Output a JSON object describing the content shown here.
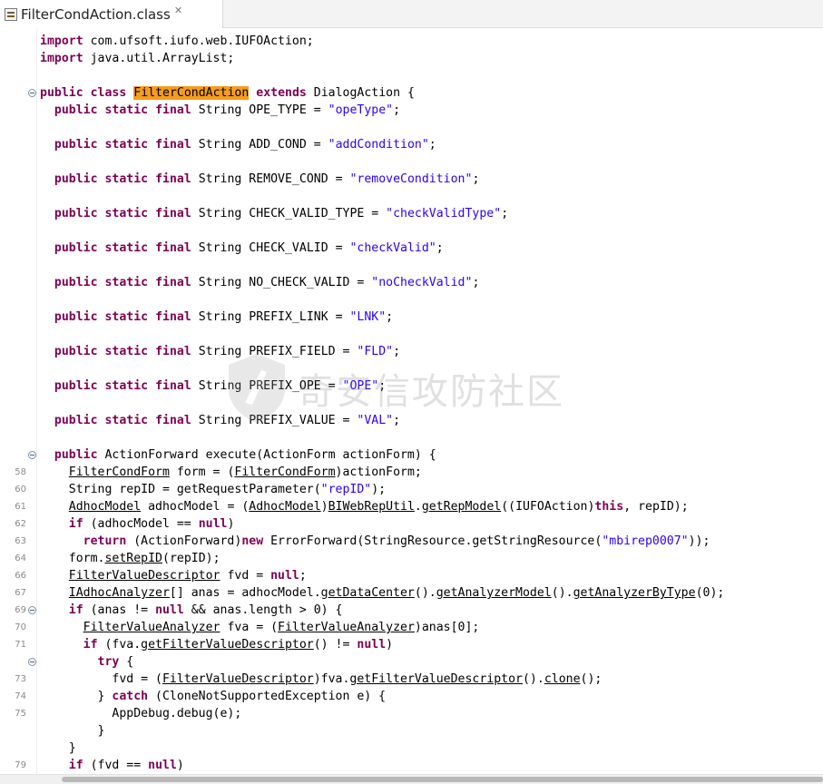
{
  "tab": {
    "title": "FilterCondAction.class",
    "icon": "class-file-icon",
    "close_glyph": "✕"
  },
  "watermark": {
    "text": "奇安信攻防社区"
  },
  "colors": {
    "keyword": "#7f0055",
    "string": "#2a00ff",
    "highlight": "#f59c1e",
    "line_number": "#8a8a8a"
  },
  "lines": [
    {
      "ln": "",
      "fold": false,
      "segs": [
        [
          "kw",
          "import"
        ],
        [
          "t",
          " com.ufsoft.iufo.web.IUFOAction;"
        ]
      ]
    },
    {
      "ln": "",
      "fold": false,
      "segs": [
        [
          "kw",
          "import"
        ],
        [
          "t",
          " java.util.ArrayList;"
        ]
      ]
    },
    {
      "ln": "",
      "fold": false,
      "segs": []
    },
    {
      "ln": "",
      "fold": true,
      "segs": [
        [
          "kw",
          "public"
        ],
        [
          "t",
          " "
        ],
        [
          "kw",
          "class"
        ],
        [
          "t",
          " "
        ],
        [
          "hl",
          "FilterCondAction"
        ],
        [
          "t",
          " "
        ],
        [
          "kw",
          "extends"
        ],
        [
          "t",
          " DialogAction {"
        ]
      ]
    },
    {
      "ln": "",
      "fold": false,
      "segs": [
        [
          "t",
          "  "
        ],
        [
          "kw",
          "public"
        ],
        [
          "t",
          " "
        ],
        [
          "kw",
          "static"
        ],
        [
          "t",
          " "
        ],
        [
          "kw",
          "final"
        ],
        [
          "t",
          " String OPE_TYPE = "
        ],
        [
          "str",
          "\"opeType\""
        ],
        [
          "t",
          ";"
        ]
      ]
    },
    {
      "ln": "",
      "fold": false,
      "segs": []
    },
    {
      "ln": "",
      "fold": false,
      "segs": [
        [
          "t",
          "  "
        ],
        [
          "kw",
          "public"
        ],
        [
          "t",
          " "
        ],
        [
          "kw",
          "static"
        ],
        [
          "t",
          " "
        ],
        [
          "kw",
          "final"
        ],
        [
          "t",
          " String ADD_COND = "
        ],
        [
          "str",
          "\"addCondition\""
        ],
        [
          "t",
          ";"
        ]
      ]
    },
    {
      "ln": "",
      "fold": false,
      "segs": []
    },
    {
      "ln": "",
      "fold": false,
      "segs": [
        [
          "t",
          "  "
        ],
        [
          "kw",
          "public"
        ],
        [
          "t",
          " "
        ],
        [
          "kw",
          "static"
        ],
        [
          "t",
          " "
        ],
        [
          "kw",
          "final"
        ],
        [
          "t",
          " String REMOVE_COND = "
        ],
        [
          "str",
          "\"removeCondition\""
        ],
        [
          "t",
          ";"
        ]
      ]
    },
    {
      "ln": "",
      "fold": false,
      "segs": []
    },
    {
      "ln": "",
      "fold": false,
      "segs": [
        [
          "t",
          "  "
        ],
        [
          "kw",
          "public"
        ],
        [
          "t",
          " "
        ],
        [
          "kw",
          "static"
        ],
        [
          "t",
          " "
        ],
        [
          "kw",
          "final"
        ],
        [
          "t",
          " String CHECK_VALID_TYPE = "
        ],
        [
          "str",
          "\"checkValidType\""
        ],
        [
          "t",
          ";"
        ]
      ]
    },
    {
      "ln": "",
      "fold": false,
      "segs": []
    },
    {
      "ln": "",
      "fold": false,
      "segs": [
        [
          "t",
          "  "
        ],
        [
          "kw",
          "public"
        ],
        [
          "t",
          " "
        ],
        [
          "kw",
          "static"
        ],
        [
          "t",
          " "
        ],
        [
          "kw",
          "final"
        ],
        [
          "t",
          " String CHECK_VALID = "
        ],
        [
          "str",
          "\"checkValid\""
        ],
        [
          "t",
          ";"
        ]
      ]
    },
    {
      "ln": "",
      "fold": false,
      "segs": []
    },
    {
      "ln": "",
      "fold": false,
      "segs": [
        [
          "t",
          "  "
        ],
        [
          "kw",
          "public"
        ],
        [
          "t",
          " "
        ],
        [
          "kw",
          "static"
        ],
        [
          "t",
          " "
        ],
        [
          "kw",
          "final"
        ],
        [
          "t",
          " String NO_CHECK_VALID = "
        ],
        [
          "str",
          "\"noCheckValid\""
        ],
        [
          "t",
          ";"
        ]
      ]
    },
    {
      "ln": "",
      "fold": false,
      "segs": []
    },
    {
      "ln": "",
      "fold": false,
      "segs": [
        [
          "t",
          "  "
        ],
        [
          "kw",
          "public"
        ],
        [
          "t",
          " "
        ],
        [
          "kw",
          "static"
        ],
        [
          "t",
          " "
        ],
        [
          "kw",
          "final"
        ],
        [
          "t",
          " String PREFIX_LINK = "
        ],
        [
          "str",
          "\"LNK\""
        ],
        [
          "t",
          ";"
        ]
      ]
    },
    {
      "ln": "",
      "fold": false,
      "segs": []
    },
    {
      "ln": "",
      "fold": false,
      "segs": [
        [
          "t",
          "  "
        ],
        [
          "kw",
          "public"
        ],
        [
          "t",
          " "
        ],
        [
          "kw",
          "static"
        ],
        [
          "t",
          " "
        ],
        [
          "kw",
          "final"
        ],
        [
          "t",
          " String PREFIX_FIELD = "
        ],
        [
          "str",
          "\"FLD\""
        ],
        [
          "t",
          ";"
        ]
      ]
    },
    {
      "ln": "",
      "fold": false,
      "segs": []
    },
    {
      "ln": "",
      "fold": false,
      "segs": [
        [
          "t",
          "  "
        ],
        [
          "kw",
          "public"
        ],
        [
          "t",
          " "
        ],
        [
          "kw",
          "static"
        ],
        [
          "t",
          " "
        ],
        [
          "kw",
          "final"
        ],
        [
          "t",
          " String PREFIX_OPE = "
        ],
        [
          "str",
          "\"OPE\""
        ],
        [
          "t",
          ";"
        ]
      ]
    },
    {
      "ln": "",
      "fold": false,
      "segs": []
    },
    {
      "ln": "",
      "fold": false,
      "segs": [
        [
          "t",
          "  "
        ],
        [
          "kw",
          "public"
        ],
        [
          "t",
          " "
        ],
        [
          "kw",
          "static"
        ],
        [
          "t",
          " "
        ],
        [
          "kw",
          "final"
        ],
        [
          "t",
          " String PREFIX_VALUE = "
        ],
        [
          "str",
          "\"VAL\""
        ],
        [
          "t",
          ";"
        ]
      ]
    },
    {
      "ln": "",
      "fold": false,
      "segs": []
    },
    {
      "ln": "",
      "fold": true,
      "segs": [
        [
          "t",
          "  "
        ],
        [
          "kw",
          "public"
        ],
        [
          "t",
          " ActionForward execute(ActionForm actionForm) {"
        ]
      ]
    },
    {
      "ln": "58",
      "fold": false,
      "segs": [
        [
          "t",
          "    "
        ],
        [
          "ul",
          "FilterCondForm"
        ],
        [
          "t",
          " form = ("
        ],
        [
          "ul",
          "FilterCondForm"
        ],
        [
          "t",
          ")actionForm;"
        ]
      ]
    },
    {
      "ln": "60",
      "fold": false,
      "segs": [
        [
          "t",
          "    String repID = getRequestParameter("
        ],
        [
          "str",
          "\"repID\""
        ],
        [
          "t",
          ");"
        ]
      ]
    },
    {
      "ln": "61",
      "fold": false,
      "segs": [
        [
          "t",
          "    "
        ],
        [
          "ul",
          "AdhocModel"
        ],
        [
          "t",
          " adhocModel = ("
        ],
        [
          "ul",
          "AdhocModel"
        ],
        [
          "t",
          ")"
        ],
        [
          "ul",
          "BIWebRepUtil"
        ],
        [
          "t",
          "."
        ],
        [
          "ul",
          "getRepModel"
        ],
        [
          "t",
          "((IUFOAction)"
        ],
        [
          "kw",
          "this"
        ],
        [
          "t",
          ", repID);"
        ]
      ]
    },
    {
      "ln": "62",
      "fold": false,
      "segs": [
        [
          "t",
          "    "
        ],
        [
          "kw",
          "if"
        ],
        [
          "t",
          " (adhocModel == "
        ],
        [
          "kw",
          "null"
        ],
        [
          "t",
          ")"
        ]
      ]
    },
    {
      "ln": "63",
      "fold": false,
      "segs": [
        [
          "t",
          "      "
        ],
        [
          "kw",
          "return"
        ],
        [
          "t",
          " (ActionForward)"
        ],
        [
          "kw",
          "new"
        ],
        [
          "t",
          " ErrorForward(StringResource.getStringResource("
        ],
        [
          "str",
          "\"mbirep0007\""
        ],
        [
          "t",
          "));"
        ]
      ]
    },
    {
      "ln": "64",
      "fold": false,
      "segs": [
        [
          "t",
          "    form."
        ],
        [
          "ul",
          "setRepID"
        ],
        [
          "t",
          "(repID);"
        ]
      ]
    },
    {
      "ln": "66",
      "fold": false,
      "segs": [
        [
          "t",
          "    "
        ],
        [
          "ul",
          "FilterValueDescriptor"
        ],
        [
          "t",
          " fvd = "
        ],
        [
          "kw",
          "null"
        ],
        [
          "t",
          ";"
        ]
      ]
    },
    {
      "ln": "67",
      "fold": false,
      "segs": [
        [
          "t",
          "    "
        ],
        [
          "ul",
          "IAdhocAnalyzer"
        ],
        [
          "t",
          "[] anas = adhocModel."
        ],
        [
          "ul",
          "getDataCenter"
        ],
        [
          "t",
          "()."
        ],
        [
          "ul",
          "getAnalyzerModel"
        ],
        [
          "t",
          "()."
        ],
        [
          "ul",
          "getAnalyzerByType"
        ],
        [
          "t",
          "(0);"
        ]
      ]
    },
    {
      "ln": "69",
      "fold": true,
      "segs": [
        [
          "t",
          "    "
        ],
        [
          "kw",
          "if"
        ],
        [
          "t",
          " (anas != "
        ],
        [
          "kw",
          "null"
        ],
        [
          "t",
          " && anas.length > 0) {"
        ]
      ]
    },
    {
      "ln": "70",
      "fold": false,
      "segs": [
        [
          "t",
          "      "
        ],
        [
          "ul",
          "FilterValueAnalyzer"
        ],
        [
          "t",
          " fva = ("
        ],
        [
          "ul",
          "FilterValueAnalyzer"
        ],
        [
          "t",
          ")anas[0];"
        ]
      ]
    },
    {
      "ln": "71",
      "fold": false,
      "segs": [
        [
          "t",
          "      "
        ],
        [
          "kw",
          "if"
        ],
        [
          "t",
          " (fva."
        ],
        [
          "ul",
          "getFilterValueDescriptor"
        ],
        [
          "t",
          "() != "
        ],
        [
          "kw",
          "null"
        ],
        [
          "t",
          ")"
        ]
      ]
    },
    {
      "ln": "",
      "fold": true,
      "segs": [
        [
          "t",
          "        "
        ],
        [
          "kw",
          "try"
        ],
        [
          "t",
          " {"
        ]
      ]
    },
    {
      "ln": "73",
      "fold": false,
      "segs": [
        [
          "t",
          "          fvd = ("
        ],
        [
          "ul",
          "FilterValueDescriptor"
        ],
        [
          "t",
          ")fva."
        ],
        [
          "ul",
          "getFilterValueDescriptor"
        ],
        [
          "t",
          "()."
        ],
        [
          "ul",
          "clone"
        ],
        [
          "t",
          "();"
        ]
      ]
    },
    {
      "ln": "74",
      "fold": false,
      "segs": [
        [
          "t",
          "        } "
        ],
        [
          "kw",
          "catch"
        ],
        [
          "t",
          " (CloneNotSupportedException e) {"
        ]
      ]
    },
    {
      "ln": "75",
      "fold": false,
      "segs": [
        [
          "t",
          "          AppDebug.debug(e);"
        ]
      ]
    },
    {
      "ln": "",
      "fold": false,
      "segs": [
        [
          "t",
          "        }"
        ]
      ]
    },
    {
      "ln": "",
      "fold": false,
      "segs": [
        [
          "t",
          "    }"
        ]
      ]
    },
    {
      "ln": "79",
      "fold": false,
      "segs": [
        [
          "t",
          "    "
        ],
        [
          "kw",
          "if"
        ],
        [
          "t",
          " (fvd == "
        ],
        [
          "kw",
          "null"
        ],
        [
          "t",
          ")"
        ]
      ]
    }
  ]
}
